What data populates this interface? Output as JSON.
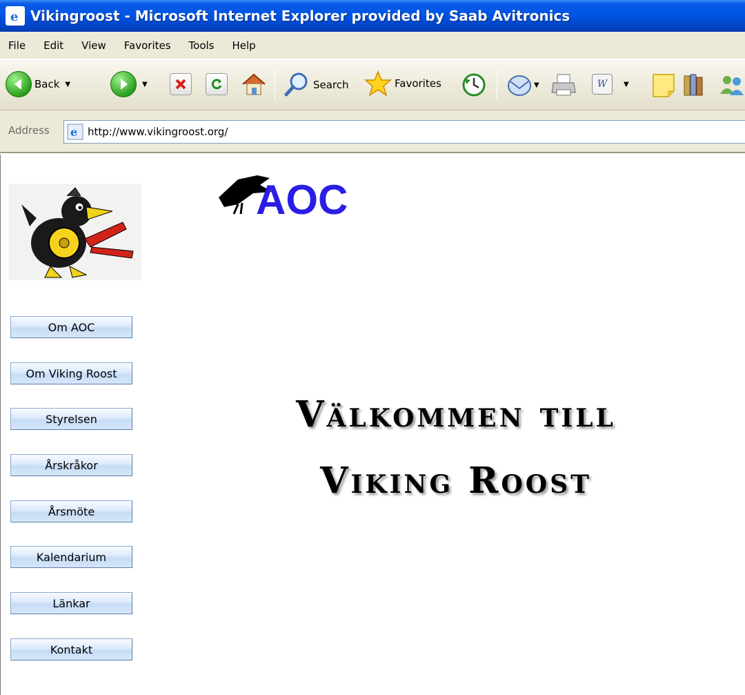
{
  "window": {
    "title": "Vikingroost - Microsoft Internet Explorer provided by Saab Avitronics"
  },
  "menu": [
    "File",
    "Edit",
    "View",
    "Favorites",
    "Tools",
    "Help"
  ],
  "toolbar": {
    "back_label": "Back",
    "search_label": "Search",
    "favorites_label": "Favorites"
  },
  "address": {
    "label": "Address",
    "url": "http://www.vikingroost.org/"
  },
  "page": {
    "logo_text": "AOC",
    "nav": [
      "Om AOC",
      "Om Viking Roost",
      "Styrelsen",
      "Årskråkor",
      "Årsmöte",
      "Kalendarium",
      "Länkar",
      "Kontakt"
    ],
    "welcome_line1": "Välkommen till",
    "welcome_line2": "Viking Roost"
  }
}
